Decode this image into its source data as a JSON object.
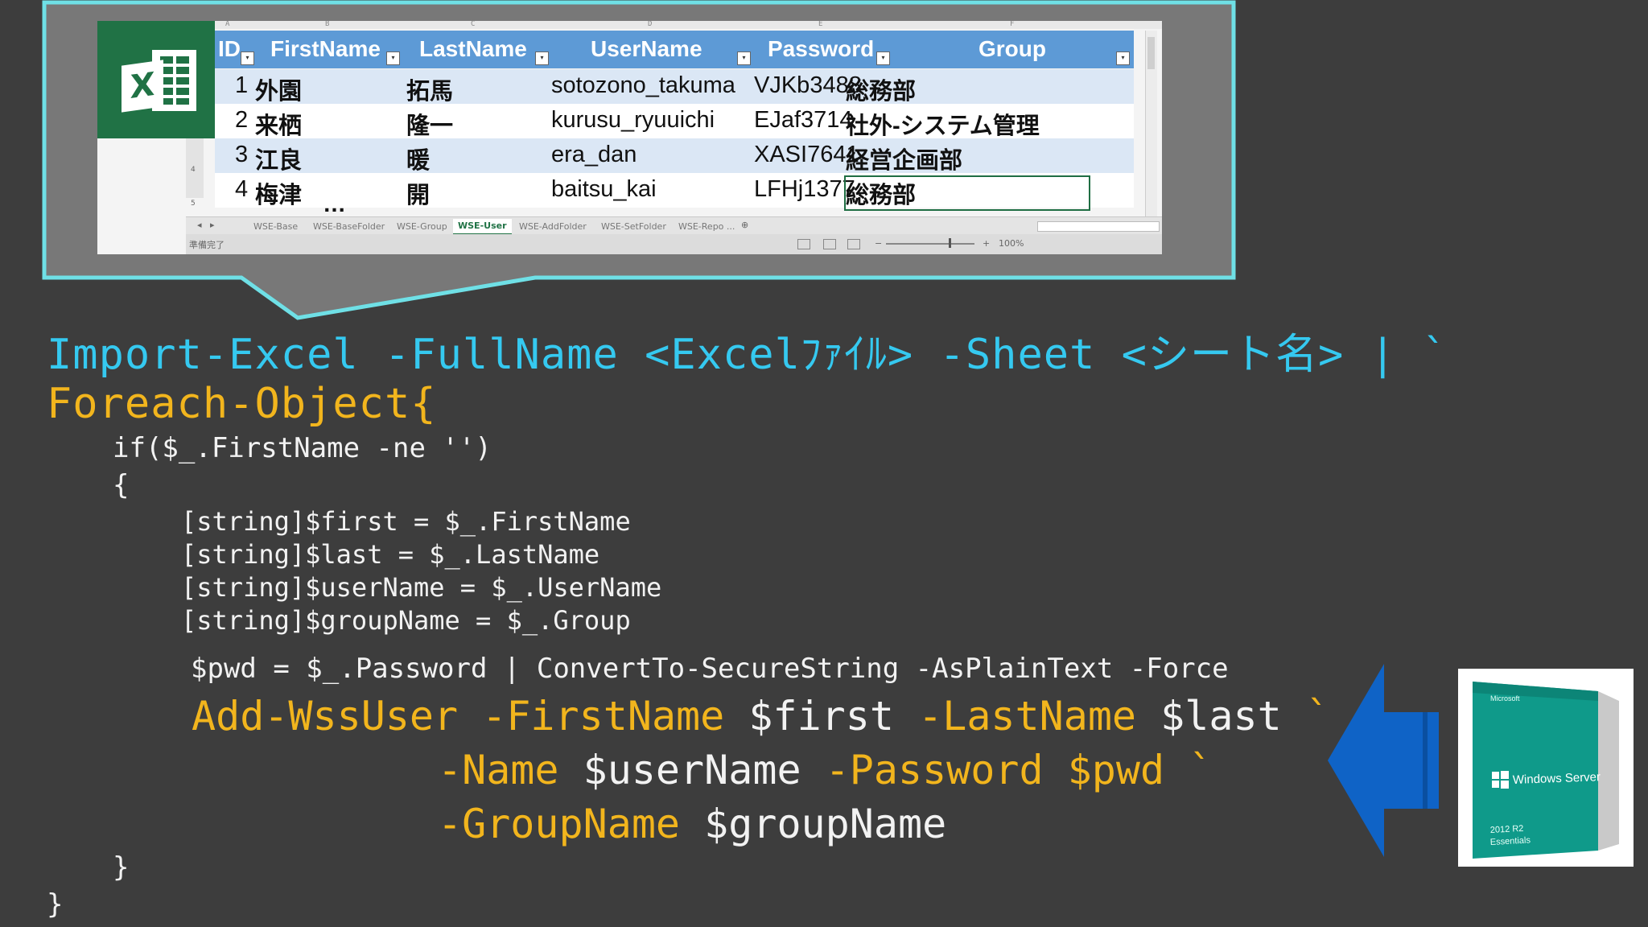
{
  "colors": {
    "background": "#3d3d3d",
    "callout_border": "#6fe0e6",
    "header": "#5d9ad6",
    "excel_green": "#207245",
    "code_cyan": "#35c9f0",
    "code_yellow": "#f2b51d",
    "arrow_blue": "#0f63c6",
    "box_teal": "#0f9a8a"
  },
  "excel": {
    "icon": "excel-icon",
    "col_letters": [
      "A",
      "B",
      "C",
      "D",
      "E",
      "F"
    ],
    "row_numbers": [
      "4",
      "5"
    ],
    "headers": [
      "ID",
      "FirstName",
      "LastName",
      "UserName",
      "Password",
      "Group"
    ],
    "rows": [
      {
        "id": "1",
        "first": "外園",
        "last": "拓馬",
        "user": "sotozono_takuma",
        "pass": "VJKb3488",
        "group": "総務部"
      },
      {
        "id": "2",
        "first": "来栖",
        "last": "隆一",
        "user": "kurusu_ryuuichi",
        "pass": "EJaf3714",
        "group": "社外-システム管理"
      },
      {
        "id": "3",
        "first": "江良",
        "last": "暖",
        "user": "era_dan",
        "pass": "XASI7641",
        "group": "経営企画部"
      },
      {
        "id": "4",
        "first": "梅津",
        "last": "開",
        "user": "baitsu_kai",
        "pass": "LFHj1377",
        "group": "総務部"
      }
    ],
    "tabs": [
      "WSE-Base",
      "WSE-BaseFolder",
      "WSE-Group",
      "WSE-User",
      "WSE-AddFolder",
      "WSE-SetFolder",
      "WSE-Repo ..."
    ],
    "active_tab": "WSE-User",
    "status": "準備完了",
    "zoom": "100%"
  },
  "code": {
    "line1_cmd": "Import-Excel",
    "line1_rest": "-FullName <Excelﾌｧｲﾙ> -Sheet <シート名> | `",
    "line2": "Foreach-Object{",
    "line3": "if($_.FirstName -ne '')",
    "line4": "{",
    "line5": "[string]$first = $_.FirstName",
    "line6": "[string]$last = $_.LastName",
    "line7": "[string]$userName = $_.UserName",
    "line8": "[string]$groupName = $_.Group",
    "line9": "$pwd = $_.Password | ConvertTo-SecureString -AsPlainText -Force",
    "line10_a": "Add-WssUser -FirstName",
    "line10_b": "$first",
    "line10_c": "-LastName",
    "line10_d": "$last",
    "line10_e": "`",
    "line11_a": "-Name",
    "line11_b": "$userName",
    "line11_c": "-Password $pwd",
    "line11_d": "`",
    "line12_a": "-GroupName",
    "line12_b": "$groupName",
    "line13": "}",
    "line14": "}"
  },
  "product": {
    "brand": "Microsoft",
    "name": "Windows Server",
    "edition_1": "2012 R2",
    "edition_2": "Essentials"
  }
}
